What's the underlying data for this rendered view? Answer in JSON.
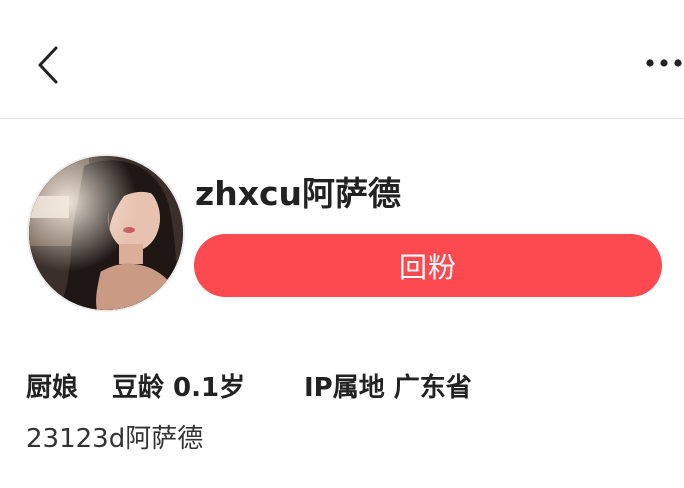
{
  "header": {
    "back_icon": "chevron-left-icon",
    "more_icon": "more-horizontal-icon"
  },
  "profile": {
    "username": "zhxcu阿萨德",
    "follow_back_label": "回粉",
    "tag": "厨娘",
    "account_age": "豆龄 0.1岁",
    "ip_location": "IP属地 广东省",
    "bio": "23123d阿萨德"
  },
  "colors": {
    "accent": "#fc4a50",
    "text": "#222222",
    "divider": "#e6e6e6"
  }
}
